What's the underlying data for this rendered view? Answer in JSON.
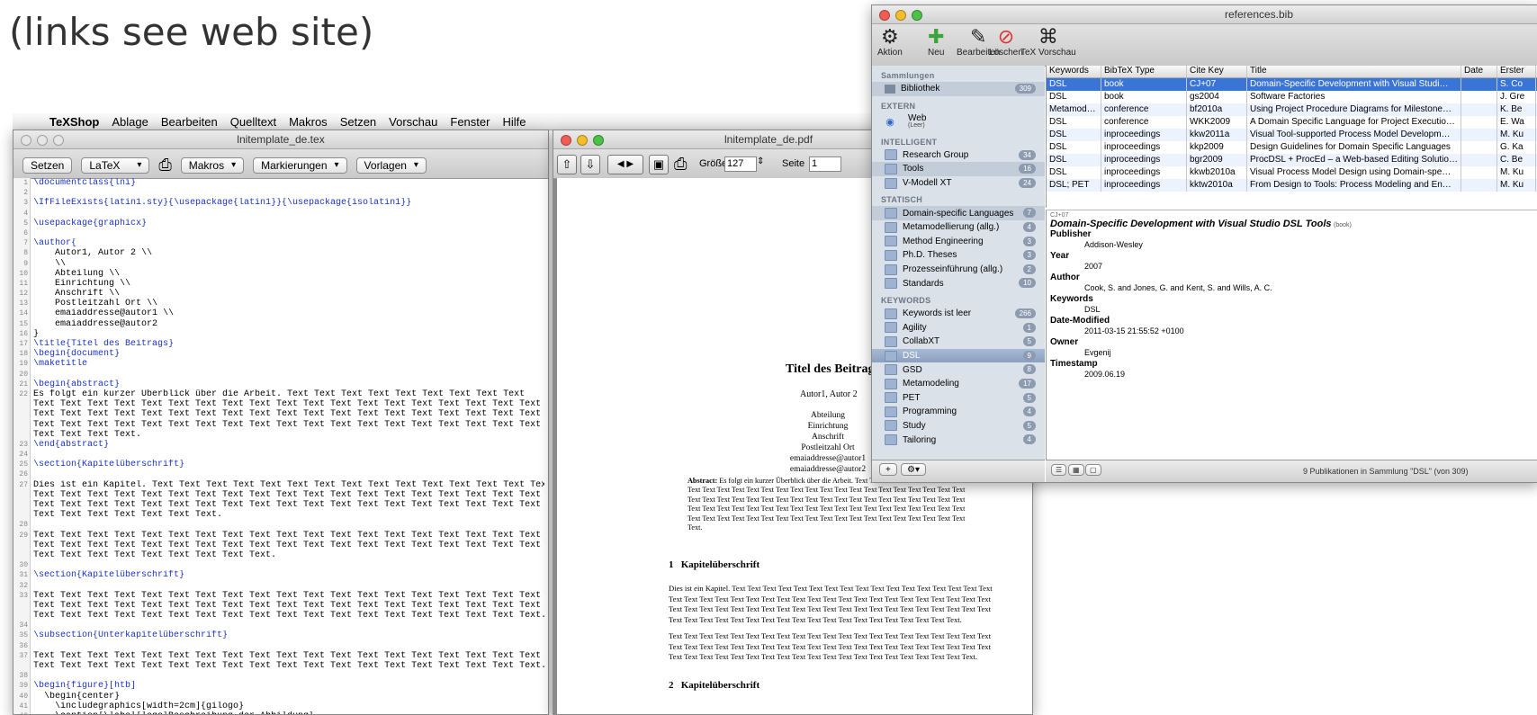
{
  "slide": {
    "line2": "(links see web site)"
  },
  "menubar": {
    "app": "TeXShop",
    "items": [
      "Ablage",
      "Bearbeiten",
      "Quelltext",
      "Makros",
      "Setzen",
      "Vorschau",
      "Fenster",
      "Hilfe"
    ]
  },
  "editor": {
    "title": "lnitemplate_de.tex",
    "toolbar": {
      "typeset": "Setzen",
      "engine": "LaTeX",
      "macros": "Makros",
      "marks": "Markierungen",
      "templates": "Vorlagen"
    },
    "lines": [
      "\\documentclass{lni}",
      "",
      "\\IfFileExists{latin1.sty}{\\usepackage{latin1}}{\\usepackage{isolatin1}}",
      "",
      "\\usepackage{graphicx}",
      "",
      "\\author{",
      "    Autor1, Autor 2 \\\\",
      "    \\\\",
      "    Abteilung \\\\",
      "    Einrichtung \\\\",
      "    Anschrift \\\\",
      "    Postleitzahl Ort \\\\",
      "    emaiaddresse@autor1 \\\\",
      "    emaiaddresse@autor2",
      "}",
      "\\title{Titel des Beitrags}",
      "\\begin{document}",
      "\\maketitle",
      "",
      "\\begin{abstract}",
      "Es folgt ein kurzer Überblick über die Arbeit. Text Text Text Text Text Text Text Text Text",
      "Text Text Text Text Text Text Text Text Text Text Text Text Text Text Text Text Text Text Text Text",
      "Text Text Text Text Text Text Text Text Text Text Text Text Text Text Text Text Text Text Text Text",
      "Text Text Text Text Text Text Text Text Text Text Text Text Text Text Text Text Text Text Text Text",
      "Text Text Text Text.",
      "\\end{abstract}",
      "",
      "\\section{Kapitelüberschrift}",
      "",
      "Dies ist ein Kapitel. Text Text Text Text Text Text Text Text Text Text Text Text Text Text Text",
      "Text Text Text Text Text Text Text Text Text Text Text Text Text Text Text Text Text Text Text Text",
      "Text Text Text Text Text Text Text Text Text Text Text Text Text Text Text Text Text Text Text Text",
      "Text Text Text Text Text Text Text.",
      "",
      "Text Text Text Text Text Text Text Text Text Text Text Text Text Text Text Text Text Text Text Text",
      "Text Text Text Text Text Text Text Text Text Text Text Text Text Text Text Text Text Text Text Text",
      "Text Text Text Text Text Text Text Text Text.",
      "",
      "\\section{Kapitelüberschrift}",
      "",
      "Text Text Text Text Text Text Text Text Text Text Text Text Text Text Text Text Text Text Text Text",
      "Text Text Text Text Text Text Text Text Text Text Text Text Text Text Text Text Text Text Text Text",
      "Text Text Text Text Text Text Text Text Text Text Text Text Text Text Text Text Text Text Text.",
      "",
      "\\subsection{Unterkapitelüberschrift}",
      "",
      "Text Text Text Text Text Text Text Text Text Text Text Text Text Text Text Text Text Text Text Text",
      "Text Text Text Text Text Text Text Text Text Text Text Text Text Text Text Text Text Text Text.",
      "",
      "\\begin{figure}[htb]",
      "  \\begin{center}",
      "    \\includegraphics[width=2cm]{gilogo}",
      "    \\caption{\\label{logo}Beschreibung der Abbildung}"
    ],
    "line_numbers": [
      "1",
      "2",
      "3",
      "4",
      "5",
      "6",
      "7",
      "8",
      "9",
      "10",
      "11",
      "12",
      "13",
      "14",
      "15",
      "16",
      "17",
      "18",
      "19",
      "20",
      "21",
      "22",
      "",
      "",
      "",
      "",
      "23",
      "24",
      "25",
      "26",
      "27",
      "",
      "",
      "",
      "28",
      "29",
      "",
      "",
      "30",
      "31",
      "32",
      "33",
      "",
      "",
      "34",
      "35",
      "36",
      "37",
      "",
      "38",
      "39",
      "40",
      "41",
      "42"
    ]
  },
  "preview": {
    "title": "lnitemplate_de.pdf",
    "size_label": "Größe",
    "size_value": "127",
    "page_label": "Seite",
    "page_value": "1",
    "doc": {
      "title": "Titel des Beitrags",
      "authors": "Autor1, Autor 2",
      "affil": [
        "Abteilung",
        "Einrichtung",
        "Anschrift",
        "Postleitzahl Ort",
        "emaiaddresse@autor1",
        "emaiaddresse@autor2"
      ],
      "abstract_label": "Abstract:",
      "abstract_lines": [
        "Es folgt ein kurzer Überblick über die Arbeit. Text Text Text Text Text",
        "Text Text Text Text Text Text Text Text Text Text Text Text Text Text Text Text Text Text Text",
        "Text Text Text Text Text Text Text Text Text Text Text Text Text Text Text Text Text Text Text",
        "Text Text Text Text Text Text Text Text Text Text Text Text Text Text Text Text Text Text Text",
        "Text Text Text Text Text Text Text Text Text Text Text Text Text Text Text Text Text Text Text",
        "Text."
      ],
      "sec1": "1   Kapitelüberschrift",
      "para1": [
        "Dies ist ein Kapitel. Text Text Text Text Text Text Text Text Text Text Text Text Text Text Text Text Text",
        "Text Text Text Text Text Text Text Text Text Text Text Text Text Text Text Text Text Text Text Text Text",
        "Text Text Text Text Text Text Text Text Text Text Text Text Text Text Text Text Text Text Text Text Text",
        "Text Text Text Text Text Text Text Text Text Text Text Text Text Text Text Text Text Text Text."
      ],
      "para2": [
        "Text Text Text Text Text Text Text Text Text Text Text Text Text Text Text Text Text Text Text Text Text",
        "Text Text Text Text Text Text Text Text Text Text Text Text Text Text Text Text Text Text Text Text Text",
        "Text Text Text Text Text Text Text Text Text Text Text Text Text Text Text Text Text Text Text Text."
      ],
      "sec2": "2   Kapitelüberschrift"
    }
  },
  "bib": {
    "title": "references.bib",
    "tools": [
      {
        "label": "Aktion",
        "icon": "gear-icon",
        "glyph": "⚙"
      },
      {
        "label": "Neu",
        "icon": "plus-icon",
        "glyph": "✚"
      },
      {
        "label": "Bearbeiten",
        "icon": "edit-icon",
        "glyph": "✎"
      },
      {
        "label": "Löschen",
        "icon": "delete-icon",
        "glyph": "⊘"
      },
      {
        "label": "TeX Vorschau",
        "icon": "preview-icon",
        "glyph": "⌘"
      }
    ],
    "sections": {
      "collections": "Sammlungen",
      "external": "EXTERN",
      "smart": "INTELLIGENT",
      "static": "STATISCH",
      "keywords": "KEYWORDS"
    },
    "library": {
      "label": "Bibliothek",
      "count": "309"
    },
    "web": {
      "label": "Web",
      "sub": "(Leer)"
    },
    "smart_items": [
      {
        "label": "Research Group",
        "count": "34"
      },
      {
        "label": "Tools",
        "count": "16"
      },
      {
        "label": "V-Modell XT",
        "count": "24"
      }
    ],
    "static_items": [
      {
        "label": "Domain-specific Languages",
        "count": "7"
      },
      {
        "label": "Metamodellierung (allg.)",
        "count": "4"
      },
      {
        "label": "Method Engineering",
        "count": "3"
      },
      {
        "label": "Ph.D. Theses",
        "count": "3"
      },
      {
        "label": "Prozesseinführung (allg.)",
        "count": "2"
      },
      {
        "label": "Standards",
        "count": "10"
      }
    ],
    "keyword_items": [
      {
        "label": "Keywords ist leer",
        "count": "266"
      },
      {
        "label": "Agility",
        "count": "1"
      },
      {
        "label": "CollabXT",
        "count": "5"
      },
      {
        "label": "DSL",
        "count": "9"
      },
      {
        "label": "GSD",
        "count": "8"
      },
      {
        "label": "Metamodeling",
        "count": "17"
      },
      {
        "label": "PET",
        "count": "5"
      },
      {
        "label": "Programming",
        "count": "4"
      },
      {
        "label": "Study",
        "count": "5"
      },
      {
        "label": "Tailoring",
        "count": "4"
      }
    ],
    "columns": [
      "Keywords",
      "BibTeX Type",
      "Cite Key",
      "Title",
      "Date",
      "Erster"
    ],
    "rows": [
      [
        "DSL",
        "book",
        "CJ+07",
        "Domain-Specific Development with Visual Studi…",
        "",
        "S. Co"
      ],
      [
        "DSL",
        "book",
        "gs2004",
        "Software Factories",
        "",
        "J. Gre"
      ],
      [
        "Metamod…",
        "conference",
        "bf2010a",
        "Using Project Procedure Diagrams for Milestone…",
        "",
        "K. Be"
      ],
      [
        "DSL",
        "conference",
        "WKK2009",
        "A Domain Specific Language for Project Executio…",
        "",
        "E. Wa"
      ],
      [
        "DSL",
        "inproceedings",
        "kkw2011a",
        "Visual Tool-supported Process Model Developm…",
        "",
        "M. Ku"
      ],
      [
        "DSL",
        "inproceedings",
        "kkp2009",
        "Design Guidelines for Domain Specific Languages",
        "",
        "G. Ka"
      ],
      [
        "DSL",
        "inproceedings",
        "bgr2009",
        "ProcDSL + ProcEd – a Web-based Editing Solutio…",
        "",
        "C. Be"
      ],
      [
        "DSL",
        "inproceedings",
        "kkwb2010a",
        "Visual Process Model Design using Domain-spe…",
        "",
        "M. Ku"
      ],
      [
        "DSL; PET",
        "inproceedings",
        "kktw2010a",
        "From Design to Tools: Process Modeling and En…",
        "",
        "M. Ku"
      ]
    ],
    "detail": {
      "key": "CJ+07",
      "title": "Domain-Specific Development with Visual Studio DSL Tools",
      "type": "(book)",
      "fields": [
        {
          "name": "Publisher",
          "value": "Addison-Wesley"
        },
        {
          "name": "Year",
          "value": "2007"
        },
        {
          "name": "Author",
          "value": "Cook, S. and Jones, G. and Kent, S. and Wills, A. C."
        },
        {
          "name": "Keywords",
          "value": "DSL"
        },
        {
          "name": "Date-Modified",
          "value": "2011-03-15 21:55:52 +0100"
        },
        {
          "name": "Owner",
          "value": "Evgenij"
        },
        {
          "name": "Timestamp",
          "value": "2009.06.19"
        }
      ]
    },
    "status": "9 Publikationen in Sammlung \"DSL\" (von 309)"
  }
}
